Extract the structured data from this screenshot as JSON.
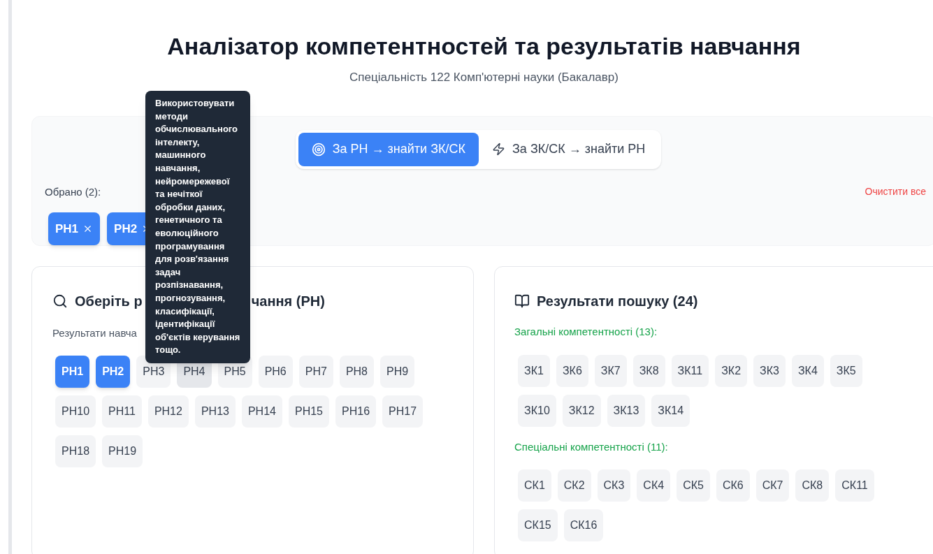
{
  "header": {
    "title": "Аналізатор компетентностей та результатів навчання",
    "subtitle": "Спеціальність 122 Комп'ютерні науки (Бакалавр)"
  },
  "modes": [
    {
      "label": "За РН → знайти ЗК/СК",
      "kind": "target",
      "selected": true
    },
    {
      "label": "За ЗК/СК → знайти РН",
      "kind": "bolt",
      "selected": false
    }
  ],
  "selection": {
    "label": "Обрано (2):",
    "clear": "Очистити все",
    "chips": [
      "РН1",
      "РН2"
    ]
  },
  "outcomes": {
    "title_start": "Оберіть р",
    "title_end": "чання (РН)",
    "hint": "Результати навча",
    "items": [
      {
        "label": "РН1",
        "selected": true,
        "hovered": false
      },
      {
        "label": "РН2",
        "selected": true,
        "hovered": false
      },
      {
        "label": "РН3",
        "selected": false,
        "hovered": false
      },
      {
        "label": "РН4",
        "selected": false,
        "hovered": true
      },
      {
        "label": "РН5",
        "selected": false,
        "hovered": false
      },
      {
        "label": "РН6",
        "selected": false,
        "hovered": false
      },
      {
        "label": "РН7",
        "selected": false,
        "hovered": false
      },
      {
        "label": "РН8",
        "selected": false,
        "hovered": false
      },
      {
        "label": "РН9",
        "selected": false,
        "hovered": false
      },
      {
        "label": "РН10",
        "selected": false,
        "hovered": false
      },
      {
        "label": "РН11",
        "selected": false,
        "hovered": false
      },
      {
        "label": "РН12",
        "selected": false,
        "hovered": false
      },
      {
        "label": "РН13",
        "selected": false,
        "hovered": false
      },
      {
        "label": "РН14",
        "selected": false,
        "hovered": false
      },
      {
        "label": "РН15",
        "selected": false,
        "hovered": false
      },
      {
        "label": "РН16",
        "selected": false,
        "hovered": false
      },
      {
        "label": "РН17",
        "selected": false,
        "hovered": false
      },
      {
        "label": "РН18",
        "selected": false,
        "hovered": false
      },
      {
        "label": "РН19",
        "selected": false,
        "hovered": false
      }
    ]
  },
  "tooltip": "Використовувати методи обчислювального інтелекту, машинного навчання, нейромережевої та нечіткої обробки даних, генетичного та еволюційного програмування для розв'язання задач розпізнавання, прогнозування, класифікації, ідентифікації об'єктів керування тощо.",
  "results": {
    "title": "Результати пошуку (24)",
    "groups": [
      {
        "title": "Загальні компетентності (13):",
        "items": [
          "ЗК1",
          "ЗК6",
          "ЗК7",
          "ЗК8",
          "ЗК11",
          "ЗК2",
          "ЗК3",
          "ЗК4",
          "ЗК5",
          "ЗК10",
          "ЗК12",
          "ЗК13",
          "ЗК14"
        ]
      },
      {
        "title": "Спеціальні компетентності (11):",
        "items": [
          "СК1",
          "СК2",
          "СК3",
          "СК4",
          "СК5",
          "СК6",
          "СК7",
          "СК8",
          "СК11",
          "СК15",
          "СК16"
        ]
      }
    ]
  }
}
